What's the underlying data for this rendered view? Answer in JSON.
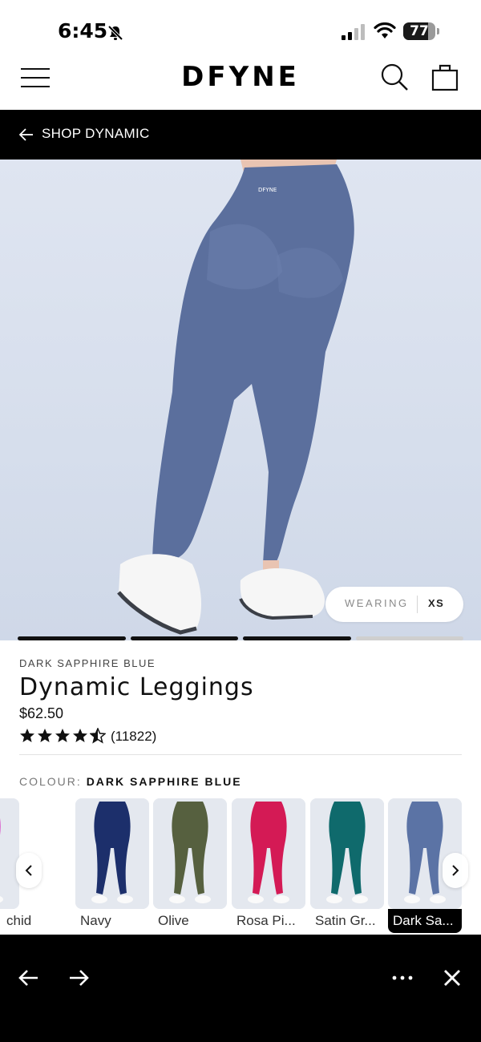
{
  "status_bar": {
    "time": "6:45",
    "battery": "77",
    "battery_level": 0.77,
    "icons": [
      "bell-slash-icon",
      "cellular-signal-icon",
      "wifi-icon",
      "battery-icon"
    ]
  },
  "header": {
    "logo": "DFYNE",
    "icons": [
      "hamburger-menu-icon",
      "search-icon",
      "shopping-bag-icon"
    ]
  },
  "back_nav": {
    "label": "SHOP DYNAMIC",
    "icon": "arrow-left-icon"
  },
  "hero": {
    "wearing_label": "WEARING",
    "wearing_size": "XS",
    "gallery_total": 4,
    "gallery_current": 3
  },
  "product": {
    "variant": "DARK SAPPHIRE BLUE",
    "title": "Dynamic Leggings",
    "price": "$62.50",
    "rating": 4.5,
    "review_count": "(11822)"
  },
  "colour": {
    "label": "COLOUR:",
    "value": "DARK SAPPHIRE BLUE"
  },
  "swatches": [
    {
      "label": "chid",
      "color": "#d62fc0"
    },
    {
      "label": "Navy",
      "color": "#1c2f6b"
    },
    {
      "label": "Olive",
      "color": "#56603f"
    },
    {
      "label": "Rosa Pi...",
      "color": "#d41a55"
    },
    {
      "label": "Satin Gr...",
      "color": "#0f6a6c"
    },
    {
      "label": "Dark Sa...",
      "color": "#5b73a5",
      "selected": true
    }
  ],
  "colors": {
    "accent": "#000000",
    "legging": "#5b6f9d",
    "hero_bg": "#d9e0ee"
  },
  "browser_bar": {
    "icons": [
      "back-arrow-icon",
      "forward-arrow-icon",
      "more-dots-icon",
      "close-icon"
    ]
  }
}
